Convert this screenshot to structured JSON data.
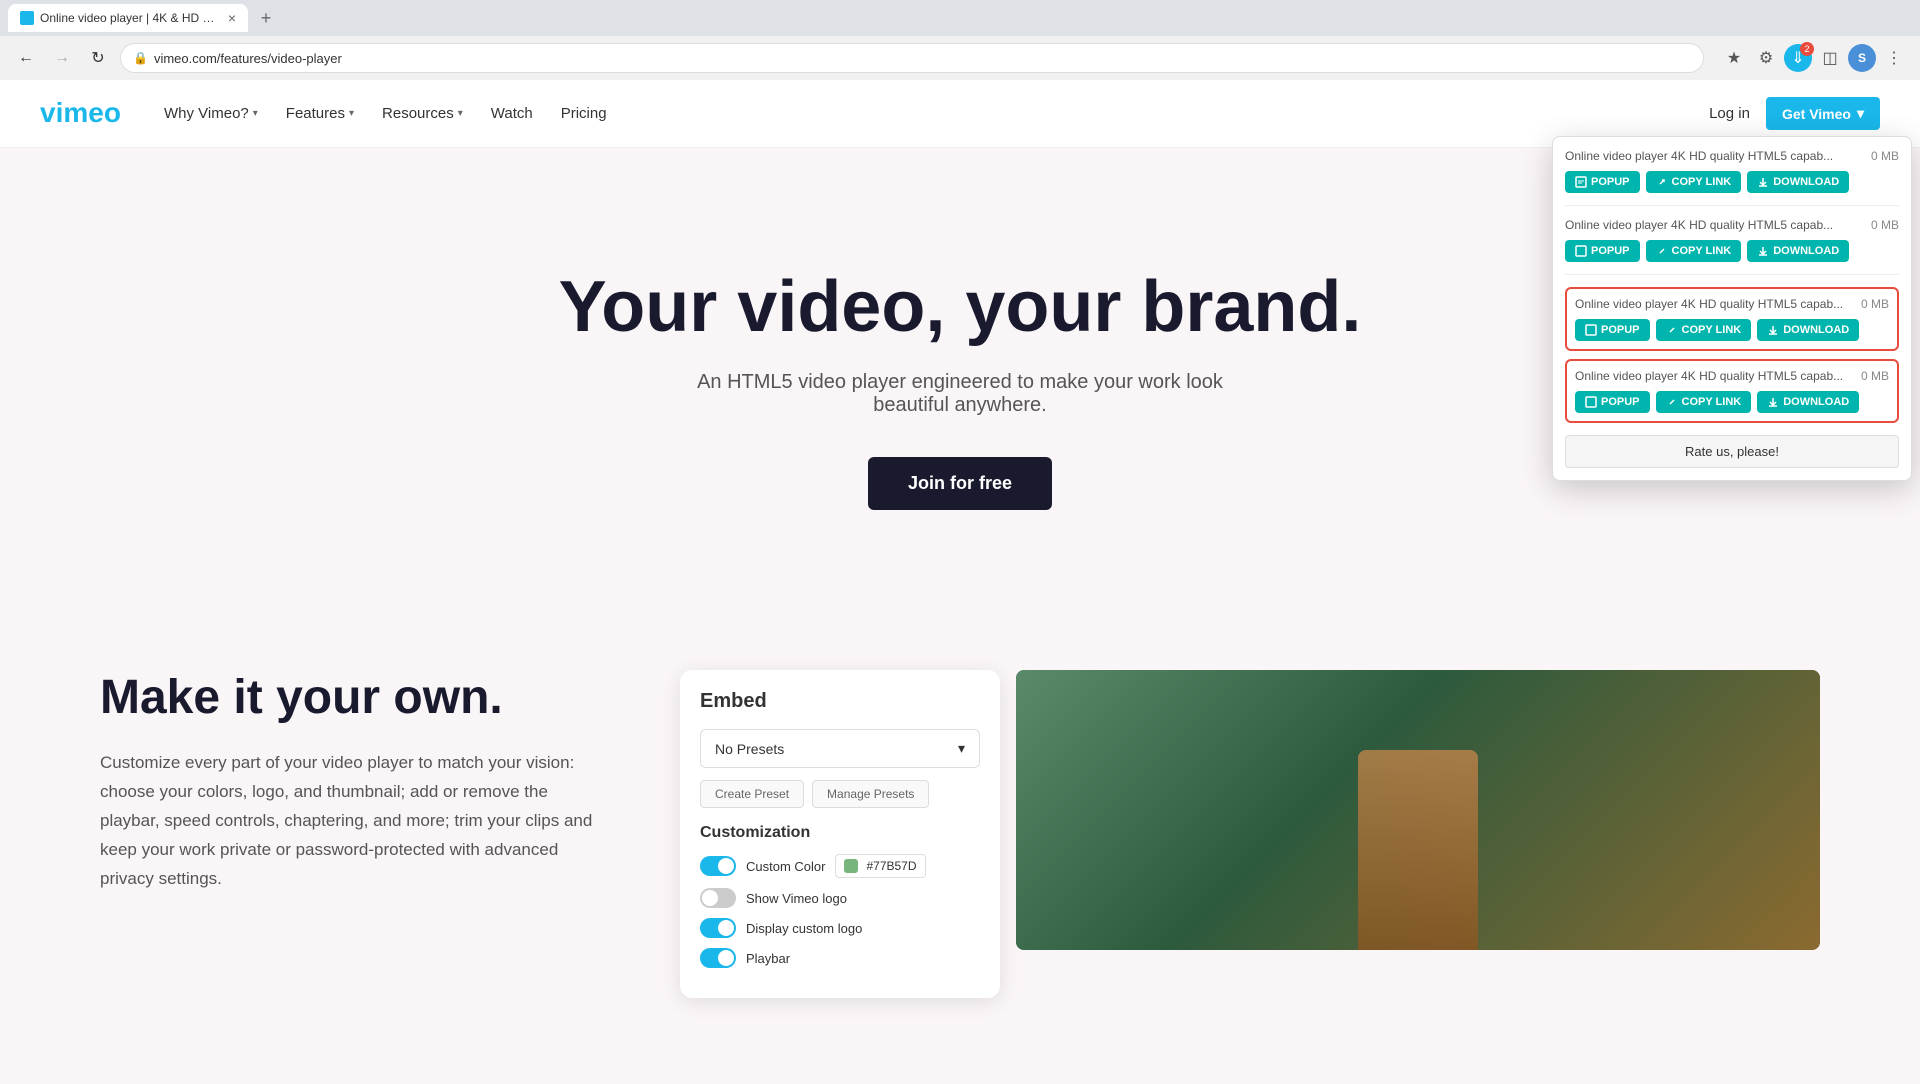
{
  "browser": {
    "tab_label": "Online video player | 4K & HD c...",
    "url": "vimeo.com/features/video-player",
    "new_tab_icon": "+",
    "back_disabled": false,
    "forward_disabled": true,
    "download_badge": "2",
    "profile_initial": "S"
  },
  "navbar": {
    "logo_alt": "Vimeo",
    "why_vimeo": "Why Vimeo?",
    "features": "Features",
    "resources": "Resources",
    "watch": "Watch",
    "pricing": "Pricing",
    "login": "Log in",
    "get_vimeo_label": "Get Vimeo",
    "get_vimeo_icon": "▾"
  },
  "hero": {
    "title": "Your video, your brand.",
    "subtitle": "An HTML5 video player engineered to make your work look beautiful anywhere.",
    "cta": "Join for free"
  },
  "make_own": {
    "title": "Make it your own.",
    "body": "Customize every part of your video player to match your vision: choose your colors, logo, and thumbnail; add or remove the playbar, speed controls, chaptering, and more; trim your clips and keep your work private or password-protected with advanced privacy settings.",
    "embed_panel": {
      "title": "Embed",
      "no_presets": "No Presets",
      "create_preset": "Create Preset",
      "manage_presets": "Manage Presets",
      "customization_title": "Customization",
      "custom_color_label": "Custom Color",
      "color_hex": "#77B57D",
      "show_vimeo_logo": "Show Vimeo logo",
      "display_custom_logo": "Display custom logo",
      "playbar_label": "Playbar"
    }
  },
  "downloader": {
    "items": [
      {
        "title": "Online video player 4K HD quality HTML5 capab...",
        "size": "0 MB",
        "popup_label": "POPUP",
        "copy_label": "COPY LINK",
        "download_label": "DOWNLOAD"
      },
      {
        "title": "Online video player 4K HD quality HTML5 capab...",
        "size": "0 MB",
        "popup_label": "POPUP",
        "copy_label": "COPY LINK",
        "download_label": "DOWNLOAD"
      },
      {
        "title": "Online video player 4K HD quality HTML5 capab...",
        "size": "0 MB",
        "popup_label": "POPUP",
        "copy_label": "COPY LINK",
        "download_label": "DOWNLOAD"
      },
      {
        "title": "Online video player 4K HD quality HTML5 capab...",
        "size": "0 MB",
        "popup_label": "POPUP",
        "copy_label": "COPY LINK",
        "download_label": "DOWNLOAD"
      }
    ],
    "rate_label": "Rate us, please!"
  }
}
